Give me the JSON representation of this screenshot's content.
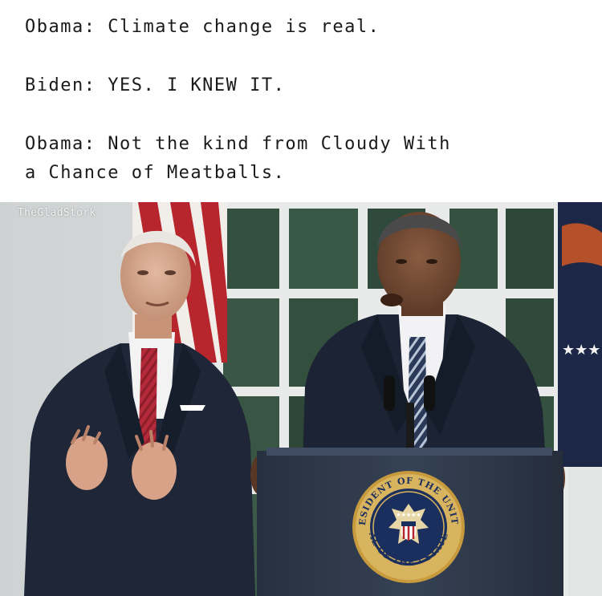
{
  "caption": {
    "line1": "Obama: Climate change is real.",
    "line2": "Biden: YES. I KNEW IT.",
    "line3": "Obama: Not the kind from Cloudy With",
    "line4": "a Chance of Meatballs."
  },
  "watermark": "TheGladStork",
  "photo": {
    "seal_text_top": "PRESIDENT OF THE UNITED",
    "seal_text_bottom": "SEAL OF THE · STATES ·"
  },
  "colors": {
    "suit": "#1c2435",
    "podium": "#2f3a4c",
    "seal_gold": "#c79a3e",
    "seal_blue": "#1b2f5e",
    "window_green": "#2f4a3c",
    "flag_red": "#b8262d"
  }
}
